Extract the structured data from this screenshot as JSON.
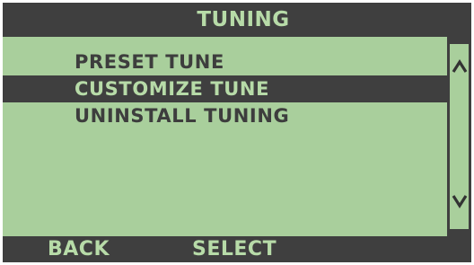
{
  "title": "TUNING",
  "menu": {
    "items": [
      {
        "label": "PRESET TUNE",
        "selected": false
      },
      {
        "label": "CUSTOMIZE TUNE",
        "selected": true
      },
      {
        "label": "UNINSTALL TUNING",
        "selected": false
      }
    ]
  },
  "scroll": {
    "up_glyph": "^",
    "down_glyph": "v"
  },
  "softkeys": {
    "left": "BACK",
    "right": "SELECT"
  },
  "colors": {
    "screen_background": "#a9cf9c",
    "bar_background": "#3f3f3f",
    "highlight_text": "#b7dba8",
    "body_text": "#3d3d3d"
  }
}
